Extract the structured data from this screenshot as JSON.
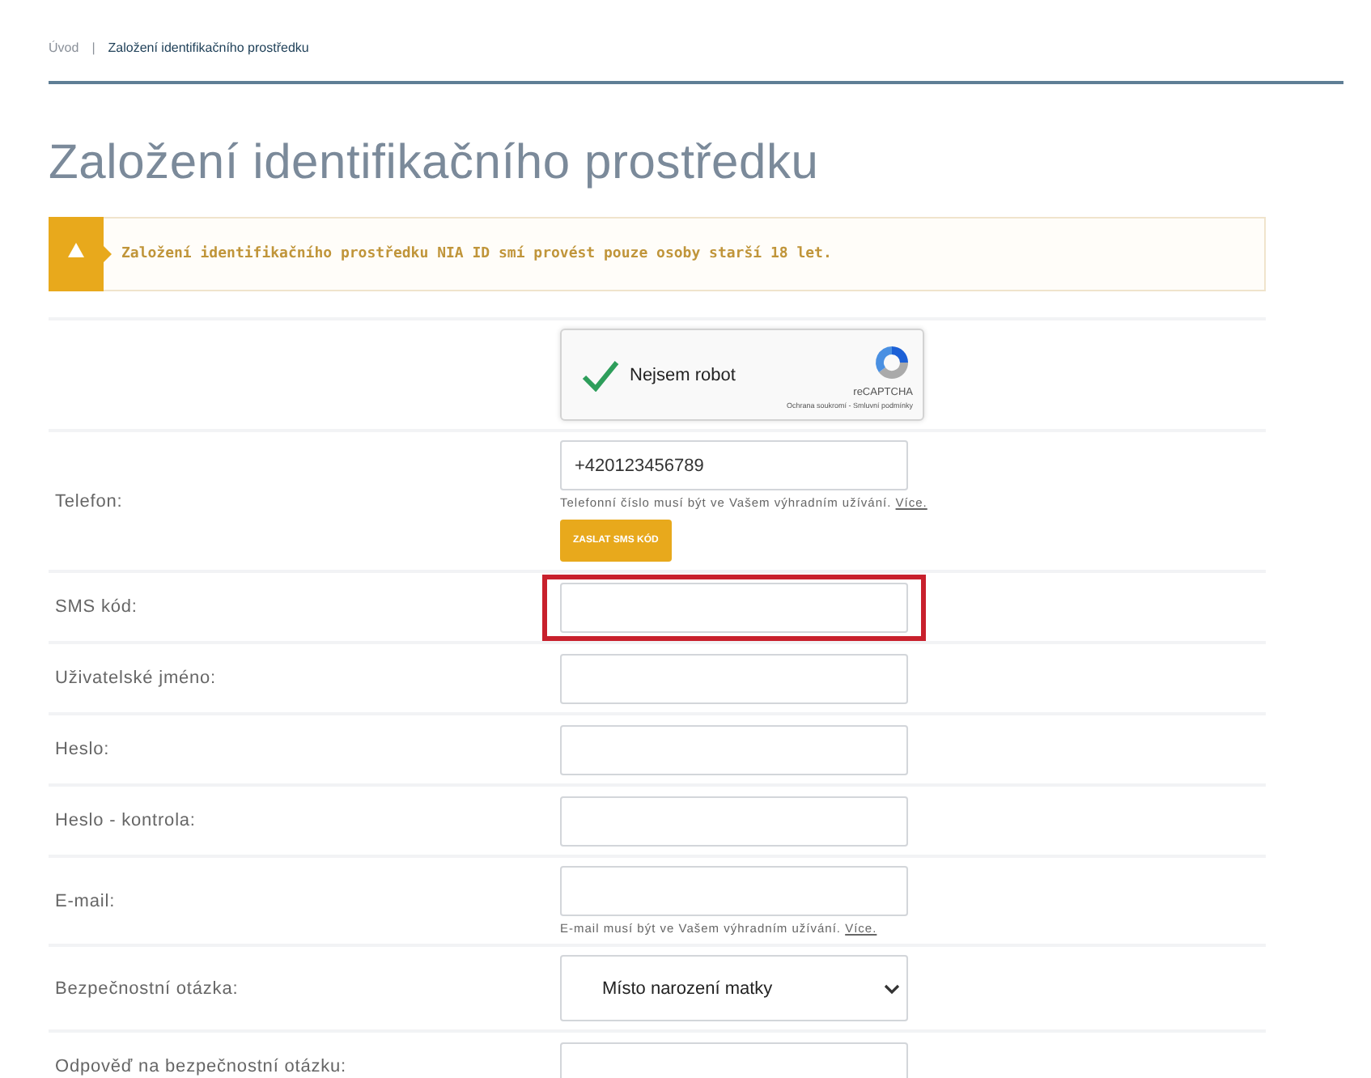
{
  "breadcrumb": [
    {
      "label": "Úvod",
      "current": false
    },
    {
      "label": "Založení identifikačního prostředku",
      "current": true
    }
  ],
  "breadcrumb_separator": "|",
  "title": "Založení identifikačního prostředku",
  "alert": {
    "text": "Založení identifikačního prostředku NIA ID smí provést pouze osoby starší 18 let."
  },
  "form": [
    {
      "kind": "captcha",
      "checked": true,
      "text": "Nejsem robot",
      "brand": "reCAPTCHA",
      "links": "Ochrana soukromí - Smluvní podmínky"
    },
    {
      "kind": "text",
      "label": "Telefon:",
      "value": "+420123456789",
      "hint": "Telefonní číslo musí být ve Vašem výhradním užívání.",
      "hint_link": "Více.",
      "button": "ZASLAT SMS KÓD",
      "highlighted": false
    },
    {
      "kind": "text",
      "label": "SMS kód:",
      "highlighted": true
    },
    {
      "kind": "text",
      "label": "Uživatelské jméno:",
      "highlighted": false
    },
    {
      "kind": "text",
      "label": "Heslo:",
      "highlighted": false
    },
    {
      "kind": "text",
      "label": "Heslo - kontrola:",
      "highlighted": false
    },
    {
      "kind": "text",
      "label": "E-mail:",
      "hint": "E-mail musí být ve Vašem výhradním užívání.",
      "hint_link": "Více.",
      "highlighted": false
    },
    {
      "kind": "select",
      "label": "Bezpečnostní otázka:",
      "value": "Místo narození matky",
      "highlighted": false
    },
    {
      "kind": "text",
      "label": "Odpověď na bezpečnostní otázku:",
      "highlighted": false
    }
  ]
}
